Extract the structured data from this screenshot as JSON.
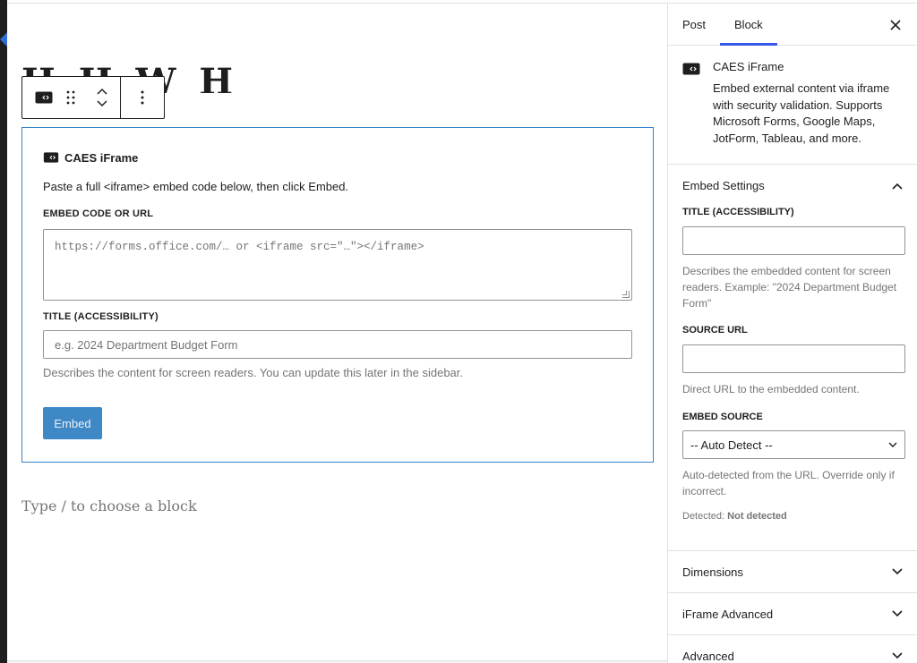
{
  "block_toolbar": {
    "embed_icon": "embed-block-icon",
    "drag_icon": "drag-handle-icon",
    "move_up_icon": "chevron-up-icon",
    "move_down_icon": "chevron-down-icon",
    "more_icon": "more-vertical-icon"
  },
  "block": {
    "title": "CAES iFrame",
    "instruction": "Paste a full <iframe> embed code below, then click Embed.",
    "embed_code_label": "Embed code or URL",
    "embed_code_placeholder": "https://forms.office.com/…  or  <iframe src=\"…\"></iframe>",
    "title_label": "Title (accessibility)",
    "title_placeholder": "e.g. 2024 Department Budget Form",
    "title_help": "Describes the content for screen readers. You can update this later in the sidebar.",
    "embed_button": "Embed"
  },
  "appender": {
    "text": "Type / to choose a block"
  },
  "sidebar": {
    "tabs": [
      {
        "label": "Post",
        "active": false
      },
      {
        "label": "Block",
        "active": true
      }
    ],
    "close_icon": "close-icon",
    "card": {
      "title": "CAES iFrame",
      "description": "Embed external content via iframe with security validation. Supports Microsoft Forms, Google Maps, JotForm, Tableau, and more."
    },
    "embed_settings": {
      "title": "Embed Settings",
      "title_label": "Title (accessibility)",
      "title_help": "Describes the embedded content for screen readers. Example: \"2024 Department Budget Form\"",
      "source_url_label": "Source URL",
      "source_url_help": "Direct URL to the embedded content.",
      "embed_source_label": "Embed source",
      "embed_source_value": "-- Auto Detect --",
      "embed_source_help": "Auto-detected from the URL. Override only if incorrect.",
      "detected_label": "Detected:",
      "detected_value": "Not detected"
    },
    "panels": [
      {
        "title": "Dimensions"
      },
      {
        "title": "iFrame Advanced"
      },
      {
        "title": "Advanced"
      }
    ]
  },
  "colors": {
    "accent": "#3858e9",
    "block_border": "#3582c4",
    "button_bg": "#3582c4",
    "text": "#1e1e1e",
    "muted": "#757575"
  }
}
